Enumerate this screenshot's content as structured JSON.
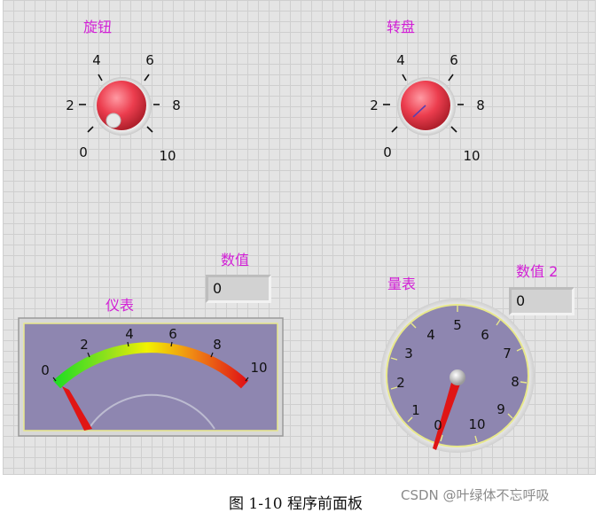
{
  "knob": {
    "label": "旋钮",
    "ticks": [
      "0",
      "2",
      "4",
      "6",
      "8",
      "10"
    ],
    "value": 0
  },
  "dial": {
    "label": "转盘",
    "ticks": [
      "0",
      "2",
      "4",
      "6",
      "8",
      "10"
    ],
    "value": 0
  },
  "numeric1": {
    "label": "数值",
    "value": "0"
  },
  "numeric2": {
    "label": "数值 2",
    "value": "0"
  },
  "meter": {
    "label": "仪表",
    "ticks": [
      "0",
      "2",
      "4",
      "6",
      "8",
      "10"
    ],
    "value": 0
  },
  "gauge": {
    "label": "量表",
    "ticks": [
      "0",
      "1",
      "2",
      "3",
      "4",
      "5",
      "6",
      "7",
      "8",
      "9",
      "10"
    ],
    "value": 0
  },
  "caption": "图 1-10  程序前面板",
  "watermark": "CSDN @叶绿体不忘呼吸",
  "colors": {
    "label": "#d21fd6",
    "knob": "#e8394a",
    "gauge_face": "#8e86b0",
    "needle": "#e01515"
  }
}
